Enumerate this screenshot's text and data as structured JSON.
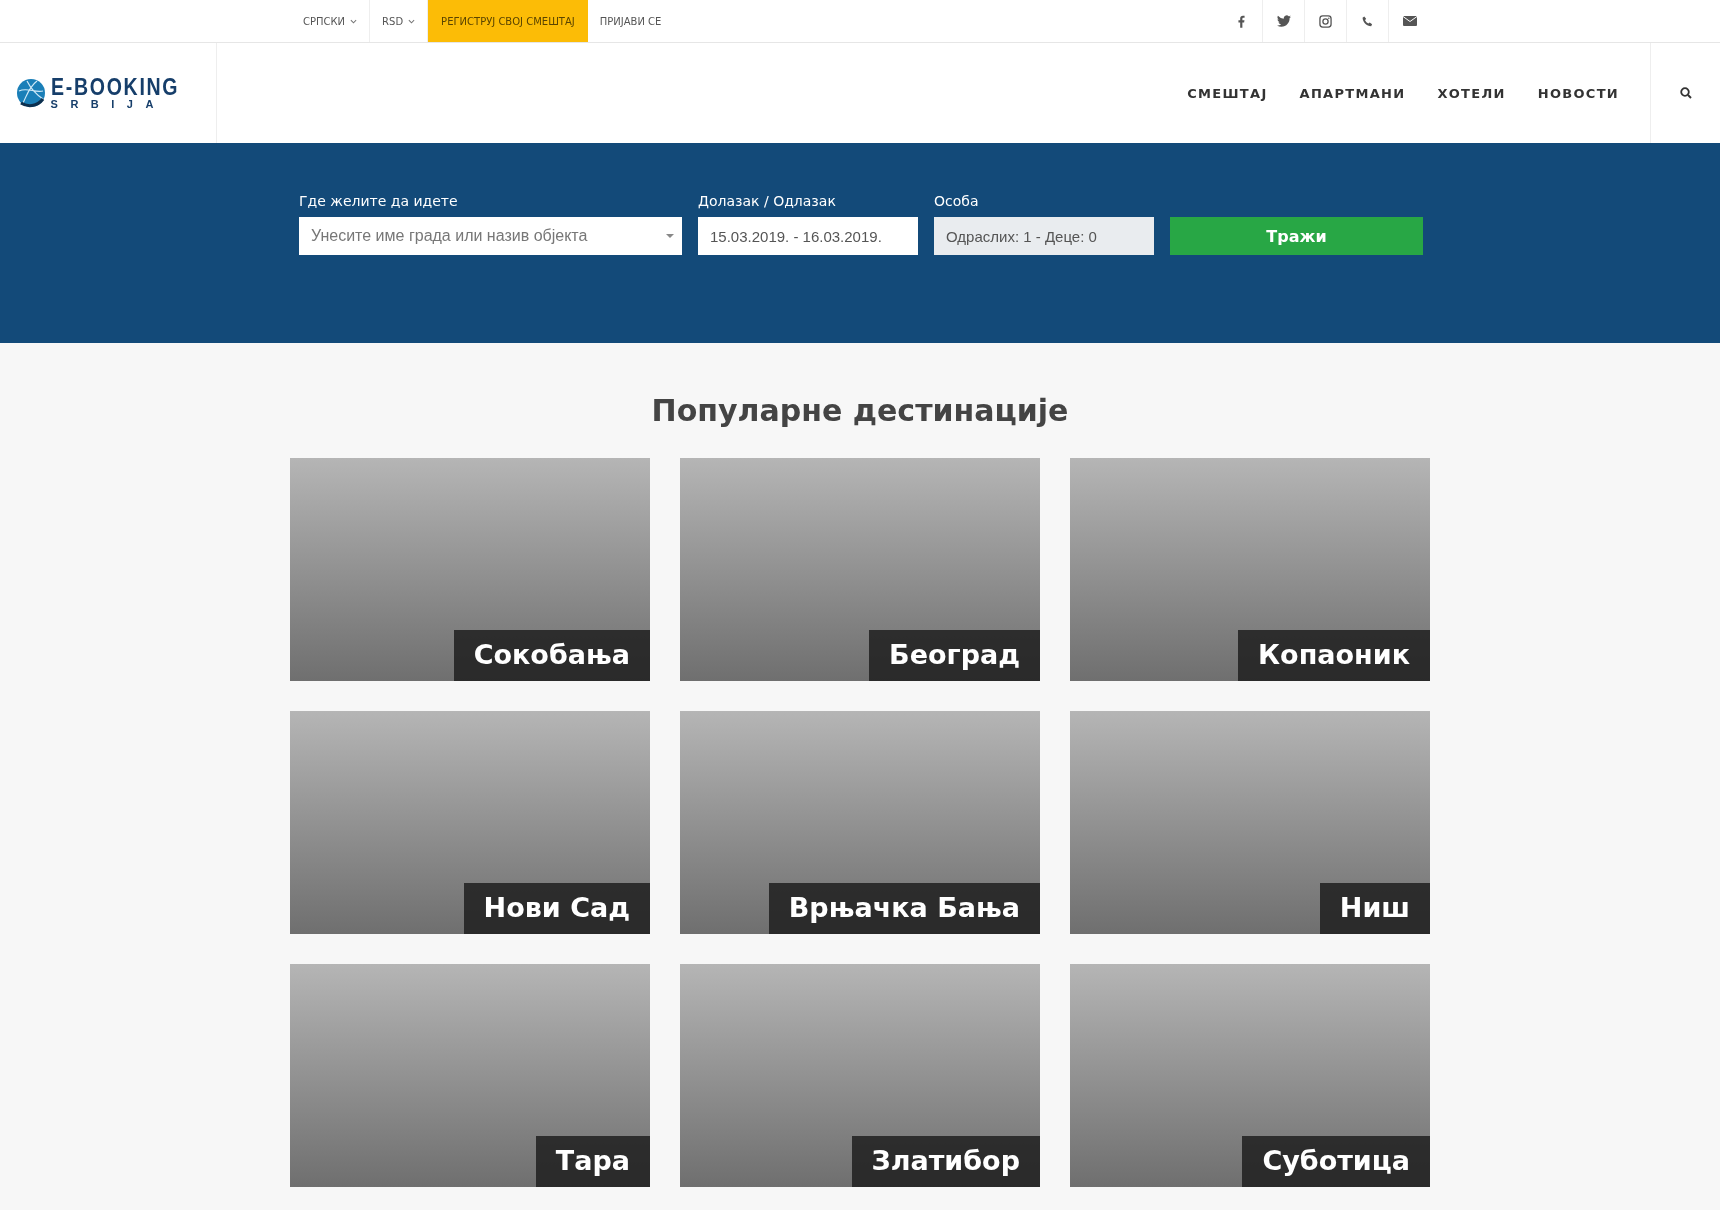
{
  "top_bar": {
    "dropdowns": [
      {
        "label": "СРПСКИ"
      },
      {
        "label": "RSD"
      }
    ],
    "links": [
      {
        "label": "РЕГИСТРУЈ СВОЈ СМЕШТАЈ",
        "highlighted": true
      },
      {
        "label": "ПРИЈАВИ СЕ",
        "highlighted": false
      }
    ]
  },
  "header": {
    "logo": {
      "title": "E-BOOKING",
      "subtitle": "SRBIJA"
    },
    "nav": [
      "СМЕШТАЈ",
      "АПАРТМАНИ",
      "ХОТЕЛИ",
      "НОВОСТИ"
    ]
  },
  "search": {
    "destination": {
      "label": "Где желите да идете",
      "placeholder": "Унесите име града или назив објекта"
    },
    "dates": {
      "label": "Долазак / Одлазак",
      "value": "15.03.2019. - 16.03.2019."
    },
    "guests": {
      "label": "Особа",
      "value": "Одраслих: 1 - Деце: 0"
    },
    "button": "Тражи"
  },
  "destinations": {
    "title": "Популарне дестинације",
    "items": [
      {
        "name": "Сокобања"
      },
      {
        "name": "Београд"
      },
      {
        "name": "Копаоник"
      },
      {
        "name": "Нови Сад"
      },
      {
        "name": "Врњачка Бања"
      },
      {
        "name": "Ниш"
      },
      {
        "name": "Тара"
      },
      {
        "name": "Златибор"
      },
      {
        "name": "Суботица"
      }
    ]
  }
}
